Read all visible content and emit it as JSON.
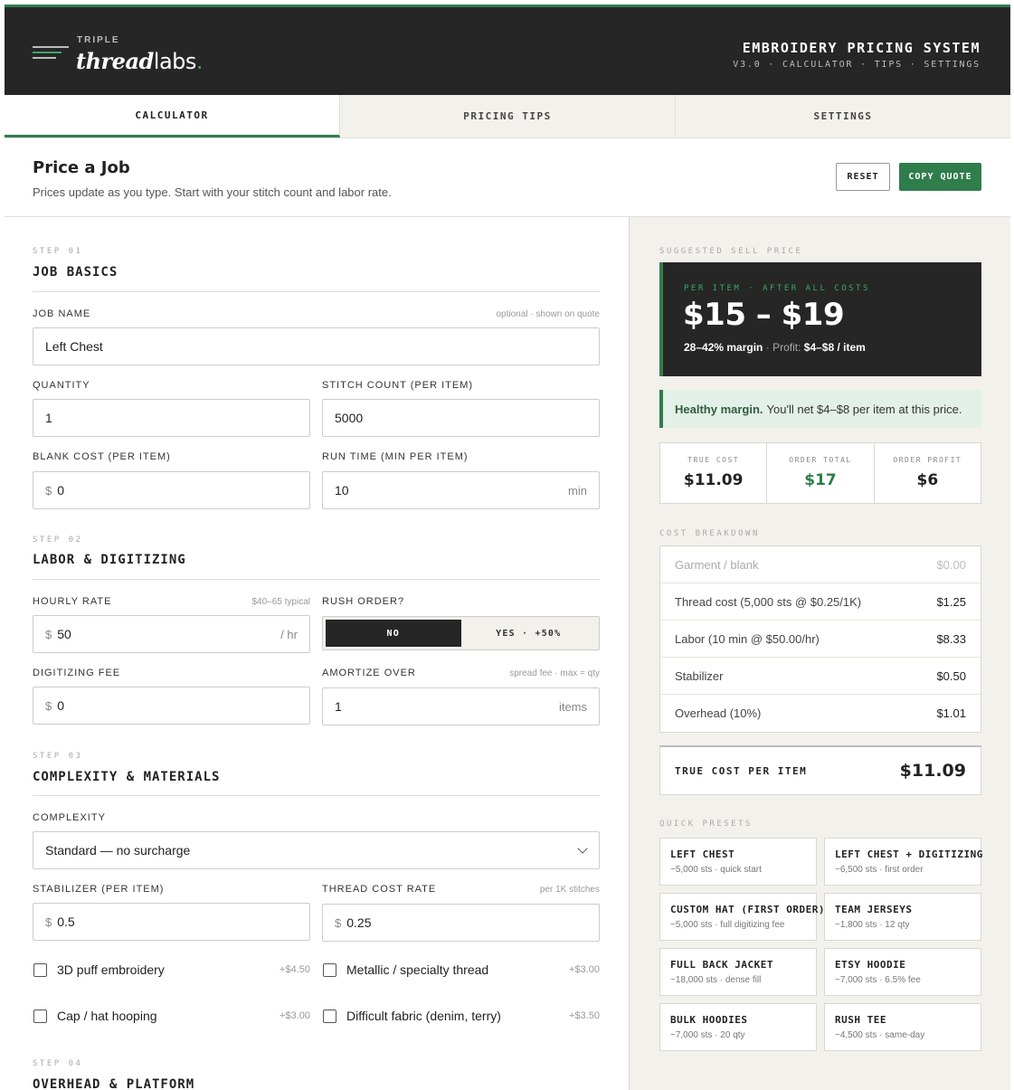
{
  "brand": {
    "small": "TRIPLE",
    "word_italic": "thread",
    "word_rest": "labs",
    "dot": ".",
    "accent_color": "#2f7d4b"
  },
  "header": {
    "title": "EMBROIDERY PRICING SYSTEM",
    "subtitle": "V3.0 · CALCULATOR · TIPS · SETTINGS"
  },
  "tabs": [
    {
      "label": "CALCULATOR",
      "active": true
    },
    {
      "label": "PRICING TIPS",
      "active": false
    },
    {
      "label": "SETTINGS",
      "active": false
    }
  ],
  "page": {
    "title": "Price a Job",
    "subtitle": "Prices update as you type. Start with your stitch count and labor rate.",
    "reset_label": "RESET",
    "copy_label": "COPY QUOTE"
  },
  "step1": {
    "step": "STEP 01",
    "title": "JOB BASICS",
    "job_name_label": "JOB NAME",
    "job_name_hint": "optional · shown on quote",
    "job_name_value": "Left Chest",
    "quantity_label": "QUANTITY",
    "quantity_value": "1",
    "stitch_label": "STITCH COUNT (PER ITEM)",
    "stitch_value": "5000",
    "blank_label": "BLANK COST (PER ITEM)",
    "blank_prefix": "$",
    "blank_value": "0",
    "runtime_label": "RUN TIME (MIN PER ITEM)",
    "runtime_value": "10",
    "runtime_suffix": "min"
  },
  "step2": {
    "step": "STEP 02",
    "title": "LABOR & DIGITIZING",
    "hourly_label": "HOURLY RATE",
    "hourly_hint": "$40–65 typical",
    "hourly_prefix": "$",
    "hourly_value": "50",
    "hourly_suffix": "/ hr",
    "rush_label": "RUSH ORDER?",
    "rush_no": "NO",
    "rush_yes": "YES · +50%",
    "digitizing_label": "DIGITIZING FEE",
    "digitizing_prefix": "$",
    "digitizing_value": "0",
    "amortize_label": "AMORTIZE OVER",
    "amortize_hint": "spread fee · max = qty",
    "amortize_value": "1",
    "amortize_suffix": "items"
  },
  "step3": {
    "step": "STEP 03",
    "title": "COMPLEXITY & MATERIALS",
    "complexity_label": "COMPLEXITY",
    "complexity_value": "Standard — no surcharge",
    "stabilizer_label": "STABILIZER (PER ITEM)",
    "stabilizer_prefix": "$",
    "stabilizer_value": "0.5",
    "thread_label": "THREAD COST RATE",
    "thread_hint": "per 1K stitches",
    "thread_prefix": "$",
    "thread_value": "0.25",
    "options": [
      {
        "label": "3D puff embroidery",
        "price": "+$4.50"
      },
      {
        "label": "Metallic / specialty thread",
        "price": "+$3.00"
      },
      {
        "label": "Cap / hat hooping",
        "price": "+$3.00"
      },
      {
        "label": "Difficult fabric (denim, terry)",
        "price": "+$3.50"
      }
    ]
  },
  "step4": {
    "step": "STEP 04",
    "title": "OVERHEAD & PLATFORM"
  },
  "summary": {
    "caption": "SUGGESTED SELL PRICE",
    "box_caption": "PER ITEM · AFTER ALL COSTS",
    "price": "$15 – $19",
    "margin": "28–42% margin",
    "sep": "·",
    "profit_label": "Profit:",
    "profit_value": "$4–$8 / item",
    "alert_bold": "Healthy margin.",
    "alert_text": "You'll net $4–$8 per item at this price.",
    "stats": [
      {
        "label": "TRUE COST",
        "value": "$11.09",
        "green": false
      },
      {
        "label": "ORDER TOTAL",
        "value": "$17",
        "green": true
      },
      {
        "label": "ORDER PROFIT",
        "value": "$6",
        "green": false
      }
    ]
  },
  "breakdown": {
    "caption": "COST BREAKDOWN",
    "rows": [
      {
        "label": "Garment / blank",
        "amount": "$0.00",
        "muted": true
      },
      {
        "label": "Thread cost (5,000 sts @ $0.25/1K)",
        "amount": "$1.25",
        "muted": false
      },
      {
        "label": "Labor (10 min @ $50.00/hr)",
        "amount": "$8.33",
        "muted": false
      },
      {
        "label": "Stabilizer",
        "amount": "$0.50",
        "muted": false
      },
      {
        "label": "Overhead (10%)",
        "amount": "$1.01",
        "muted": false
      }
    ],
    "total_label": "TRUE COST PER ITEM",
    "total_value": "$11.09"
  },
  "presets": {
    "caption": "QUICK PRESETS",
    "items": [
      {
        "name": "LEFT CHEST",
        "desc": "~5,000 sts · quick start"
      },
      {
        "name": "LEFT CHEST + DIGITIZING",
        "desc": "~6,500 sts · first order"
      },
      {
        "name": "CUSTOM HAT (FIRST ORDER)",
        "desc": "~5,000 sts · full digitizing fee"
      },
      {
        "name": "TEAM JERSEYS",
        "desc": "~1,800 sts · 12 qty"
      },
      {
        "name": "FULL BACK JACKET",
        "desc": "~18,000 sts · dense fill"
      },
      {
        "name": "ETSY HOODIE",
        "desc": "~7,000 sts · 6.5% fee"
      },
      {
        "name": "BULK HOODIES",
        "desc": "~7,000 sts · 20 qty"
      },
      {
        "name": "RUSH TEE",
        "desc": "~4,500 sts · same-day"
      }
    ]
  }
}
